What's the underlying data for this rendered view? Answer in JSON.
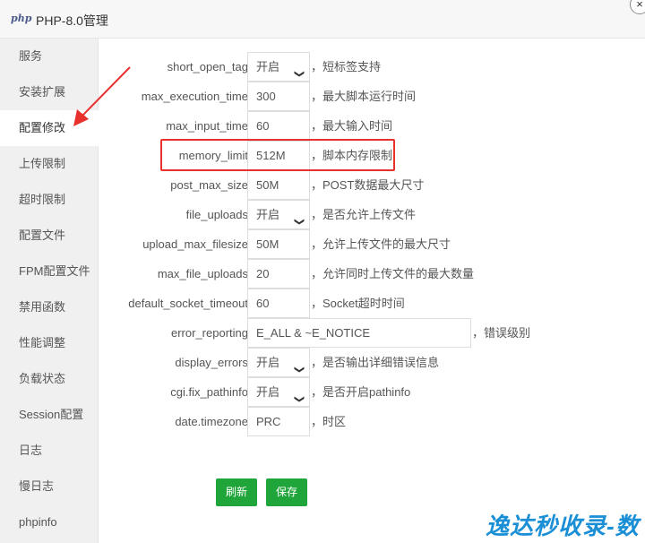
{
  "window": {
    "logo": "php",
    "title": "PHP-8.0管理",
    "close_glyph": "×"
  },
  "sidebar": {
    "items": [
      {
        "label": "服务"
      },
      {
        "label": "安装扩展"
      },
      {
        "label": "配置修改",
        "active": true
      },
      {
        "label": "上传限制"
      },
      {
        "label": "超时限制"
      },
      {
        "label": "配置文件"
      },
      {
        "label": "FPM配置文件"
      },
      {
        "label": "禁用函数"
      },
      {
        "label": "性能调整"
      },
      {
        "label": "负载状态"
      },
      {
        "label": "Session配置"
      },
      {
        "label": "日志"
      },
      {
        "label": "慢日志"
      },
      {
        "label": "phpinfo"
      }
    ]
  },
  "settings": [
    {
      "label": "short_open_tag",
      "type": "select",
      "value": "开启",
      "desc": "，短标签支持"
    },
    {
      "label": "max_execution_time",
      "type": "input",
      "value": "300",
      "desc": "，最大脚本运行时间"
    },
    {
      "label": "max_input_time",
      "type": "input",
      "value": "60",
      "desc": "，最大输入时间"
    },
    {
      "label": "memory_limit",
      "type": "input",
      "value": "512M",
      "desc": "，脚本内存限制",
      "highlighted": true
    },
    {
      "label": "post_max_size",
      "type": "input",
      "value": "50M",
      "desc": "，POST数据最大尺寸"
    },
    {
      "label": "file_uploads",
      "type": "select",
      "value": "开启",
      "desc": "，是否允许上传文件"
    },
    {
      "label": "upload_max_filesize",
      "type": "input",
      "value": "50M",
      "desc": "，允许上传文件的最大尺寸"
    },
    {
      "label": "max_file_uploads",
      "type": "input",
      "value": "20",
      "desc": "，允许同时上传文件的最大数量"
    },
    {
      "label": "default_socket_timeout",
      "type": "input",
      "value": "60",
      "desc": "，Socket超时时间"
    },
    {
      "label": "error_reporting",
      "type": "wide",
      "value": "E_ALL & ~E_NOTICE",
      "desc": "，错误级别"
    },
    {
      "label": "display_errors",
      "type": "select",
      "value": "开启",
      "desc": "，是否输出详细错误信息"
    },
    {
      "label": "cgi.fix_pathinfo",
      "type": "select",
      "value": "开启",
      "desc": "，是否开启pathinfo"
    },
    {
      "label": "date.timezone",
      "type": "input",
      "value": "PRC",
      "desc": "，时区"
    }
  ],
  "buttons": {
    "refresh": "刷新",
    "save": "保存"
  },
  "colors": {
    "accent_green": "#20a53a",
    "highlight_red": "#e8302d",
    "watermark_blue": "#1a8fd6"
  },
  "watermark": {
    "text": "逸达秒收录-数"
  }
}
